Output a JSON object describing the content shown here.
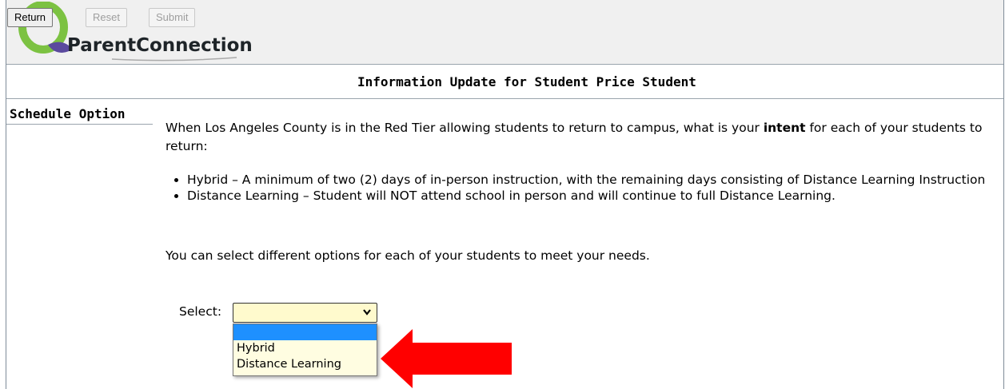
{
  "app": {
    "logo_text": "ParentConnection"
  },
  "toolbar": {
    "return_label": "Return",
    "reset_label": "Reset",
    "submit_label": "Submit"
  },
  "page": {
    "title": "Information Update for Student Price Student"
  },
  "sidebar": {
    "title": "Schedule Option"
  },
  "content": {
    "intro_before": "When Los Angeles County is in the Red Tier allowing students to return to campus, what is your ",
    "intro_bold": "intent",
    "intro_after": " for each of your students to return:",
    "bullets": [
      "Hybrid – A minimum of two (2) days of in-person instruction, with the remaining days consisting of Distance Learning Instruction",
      "Distance Learning – Student will NOT attend school in person and will continue to full Distance Learning."
    ],
    "note": "You can select different options for each of your students to meet your needs."
  },
  "select": {
    "label": "Select:",
    "value": "",
    "options": [
      "",
      "Hybrid",
      "Distance Learning"
    ]
  },
  "colors": {
    "arrow": "#ff0000",
    "highlight": "#1e90ff",
    "select_bg": "#fffacd"
  }
}
